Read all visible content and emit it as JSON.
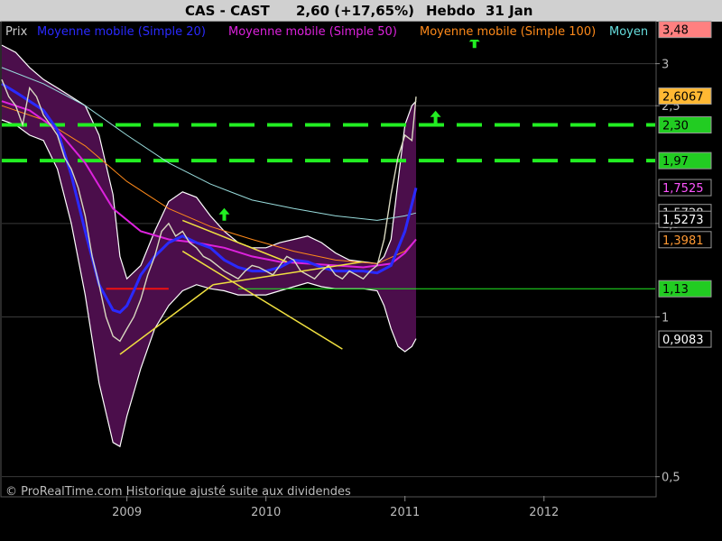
{
  "header": {
    "symbol": "CAS - CAST",
    "price_change": "2,60 (+17,65%)",
    "period": "Hebdo",
    "date": "31 Jan"
  },
  "legend": [
    {
      "label": "Prix",
      "color": "#cccccc"
    },
    {
      "label": "Moyenne mobile (Simple 20)",
      "color": "#2a2aff"
    },
    {
      "label": "Moyenne mobile (Simple 50)",
      "color": "#dd22dd"
    },
    {
      "label": "Moyenne mobile (Simple 100)",
      "color": "#ff8a1a"
    },
    {
      "label": "Moyen",
      "color": "#66dddd"
    }
  ],
  "footer": {
    "copyright": "© ProRealTime.com Historique ajusté suite aux dividendes"
  },
  "colors": {
    "price": "#d8d8c0",
    "bollinger_fill": "#4b0e4b",
    "bollinger_edge": "#ffffff",
    "sma20": "#2a2aff",
    "sma50": "#dd22dd",
    "sma100": "#ff8a1a",
    "sma200": "#99dddd",
    "green_level": "#22ee22",
    "red_level": "#ee1111",
    "trendline": "#f0e040"
  },
  "chart_data": {
    "type": "line",
    "title": "CAS - CAST",
    "period": "Hebdo",
    "y_scale": "log",
    "ylim": [
      0.46,
      3.6
    ],
    "xlim": [
      2008.1,
      2012.8
    ],
    "y_ticks": [
      "0,5",
      "1",
      "1,5",
      "2,5",
      "3"
    ],
    "x_ticks": [
      "2009",
      "2010",
      "2011",
      "2012"
    ],
    "right_labels": [
      {
        "text": "3,48",
        "value": 3.48,
        "bg": "#ff8080",
        "fg": "#000000"
      },
      {
        "text": "2,6067",
        "value": 2.6067,
        "bg": "#ffb833",
        "fg": "#000000"
      },
      {
        "text": "2,30",
        "value": 2.3,
        "bg": "#22cc22",
        "fg": "#000000"
      },
      {
        "text": "1,97",
        "value": 1.97,
        "bg": "#22cc22",
        "fg": "#000000"
      },
      {
        "text": "1,7525",
        "value": 1.7525,
        "bg": "#000000",
        "fg": "#ff55ff"
      },
      {
        "text": "1,5728",
        "value": 1.5728,
        "bg": "#000000",
        "fg": "#dddddd"
      },
      {
        "text": "1,5273",
        "value": 1.5273,
        "bg": "#000000",
        "fg": "#ffffff"
      },
      {
        "text": "1,3981",
        "value": 1.3981,
        "bg": "#000000",
        "fg": "#ff9933"
      },
      {
        "text": "1,13",
        "value": 1.13,
        "bg": "#22cc22",
        "fg": "#000000"
      },
      {
        "text": "0,9083",
        "value": 0.9083,
        "bg": "#000000",
        "fg": "#ffffff"
      }
    ],
    "levels": [
      {
        "value": 3.48,
        "style": "dashed",
        "color": "#ee1111"
      },
      {
        "value": 2.3,
        "style": "dashed",
        "color": "#22ee22"
      },
      {
        "value": 1.97,
        "style": "dashed",
        "color": "#22ee22"
      },
      {
        "value": 1.13,
        "style": "solid",
        "color": "#22ee22",
        "from": 2009.8
      }
    ],
    "price": {
      "x": [
        2008.1,
        2008.15,
        2008.2,
        2008.25,
        2008.3,
        2008.35,
        2008.4,
        2008.45,
        2008.5,
        2008.55,
        2008.6,
        2008.65,
        2008.7,
        2008.75,
        2008.8,
        2008.85,
        2008.9,
        2008.95,
        2009.0,
        2009.05,
        2009.1,
        2009.15,
        2009.2,
        2009.25,
        2009.3,
        2009.35,
        2009.4,
        2009.45,
        2009.5,
        2009.55,
        2009.6,
        2009.65,
        2009.7,
        2009.75,
        2009.8,
        2009.85,
        2009.9,
        2009.95,
        2010.0,
        2010.05,
        2010.1,
        2010.15,
        2010.2,
        2010.25,
        2010.3,
        2010.35,
        2010.4,
        2010.45,
        2010.5,
        2010.55,
        2010.6,
        2010.65,
        2010.7,
        2010.75,
        2010.8,
        2010.85,
        2010.9,
        2010.95,
        2011.0,
        2011.05,
        2011.08
      ],
      "y": [
        2.8,
        2.6,
        2.5,
        2.3,
        2.7,
        2.6,
        2.4,
        2.3,
        2.2,
        2.0,
        1.9,
        1.75,
        1.55,
        1.3,
        1.15,
        1.0,
        0.92,
        0.9,
        0.95,
        1.0,
        1.08,
        1.2,
        1.3,
        1.45,
        1.5,
        1.42,
        1.45,
        1.38,
        1.35,
        1.3,
        1.28,
        1.25,
        1.22,
        1.2,
        1.18,
        1.22,
        1.25,
        1.24,
        1.22,
        1.2,
        1.25,
        1.3,
        1.28,
        1.22,
        1.2,
        1.18,
        1.22,
        1.25,
        1.2,
        1.18,
        1.22,
        1.2,
        1.18,
        1.22,
        1.25,
        1.4,
        1.7,
        2.0,
        2.2,
        2.15,
        2.6
      ]
    },
    "sma20": {
      "x": [
        2008.1,
        2008.2,
        2008.3,
        2008.4,
        2008.5,
        2008.6,
        2008.7,
        2008.8,
        2008.9,
        2008.95,
        2009.0,
        2009.05,
        2009.1,
        2009.2,
        2009.3,
        2009.4,
        2009.5,
        2009.6,
        2009.7,
        2009.8,
        2009.9,
        2010.0,
        2010.1,
        2010.2,
        2010.3,
        2010.4,
        2010.5,
        2010.6,
        2010.7,
        2010.8,
        2010.9,
        2011.0,
        2011.08
      ],
      "y": [
        2.75,
        2.65,
        2.55,
        2.45,
        2.25,
        1.85,
        1.45,
        1.15,
        1.03,
        1.02,
        1.05,
        1.12,
        1.2,
        1.3,
        1.38,
        1.42,
        1.38,
        1.35,
        1.28,
        1.24,
        1.22,
        1.22,
        1.24,
        1.28,
        1.27,
        1.24,
        1.22,
        1.22,
        1.22,
        1.21,
        1.25,
        1.45,
        1.75
      ]
    },
    "sma50": {
      "x": [
        2008.1,
        2008.3,
        2008.5,
        2008.7,
        2008.9,
        2009.1,
        2009.3,
        2009.5,
        2009.7,
        2009.9,
        2010.1,
        2010.3,
        2010.5,
        2010.7,
        2010.9,
        2011.0,
        2011.08
      ],
      "y": [
        2.55,
        2.45,
        2.25,
        1.95,
        1.6,
        1.45,
        1.4,
        1.38,
        1.35,
        1.3,
        1.27,
        1.26,
        1.25,
        1.24,
        1.26,
        1.32,
        1.4
      ]
    },
    "sma100": {
      "x": [
        2008.1,
        2008.4,
        2008.7,
        2009.0,
        2009.3,
        2009.6,
        2009.9,
        2010.2,
        2010.5,
        2010.8,
        2011.0,
        2011.08
      ],
      "y": [
        2.5,
        2.35,
        2.1,
        1.8,
        1.6,
        1.48,
        1.4,
        1.33,
        1.28,
        1.26,
        1.33,
        1.4
      ]
    },
    "sma200": {
      "x": [
        2008.1,
        2008.4,
        2008.7,
        2009.0,
        2009.3,
        2009.6,
        2009.9,
        2010.2,
        2010.5,
        2010.8,
        2011.0,
        2011.08
      ],
      "y": [
        2.95,
        2.75,
        2.5,
        2.2,
        1.95,
        1.78,
        1.66,
        1.6,
        1.55,
        1.52,
        1.55,
        1.57
      ]
    },
    "bollinger": {
      "x": [
        2008.1,
        2008.2,
        2008.3,
        2008.4,
        2008.5,
        2008.6,
        2008.7,
        2008.8,
        2008.9,
        2008.95,
        2009.0,
        2009.1,
        2009.2,
        2009.3,
        2009.4,
        2009.5,
        2009.6,
        2009.7,
        2009.8,
        2009.9,
        2010.0,
        2010.1,
        2010.2,
        2010.3,
        2010.4,
        2010.5,
        2010.6,
        2010.7,
        2010.8,
        2010.85,
        2010.9,
        2010.95,
        2011.0,
        2011.05,
        2011.08
      ],
      "upper": [
        3.25,
        3.15,
        2.95,
        2.8,
        2.7,
        2.6,
        2.5,
        2.2,
        1.7,
        1.3,
        1.18,
        1.25,
        1.45,
        1.65,
        1.72,
        1.68,
        1.55,
        1.45,
        1.38,
        1.35,
        1.35,
        1.38,
        1.4,
        1.42,
        1.38,
        1.32,
        1.28,
        1.27,
        1.26,
        1.3,
        1.4,
        1.8,
        2.3,
        2.5,
        2.55
      ],
      "lower": [
        2.35,
        2.3,
        2.2,
        2.15,
        1.9,
        1.5,
        1.1,
        0.75,
        0.58,
        0.57,
        0.65,
        0.8,
        0.95,
        1.05,
        1.12,
        1.15,
        1.13,
        1.12,
        1.1,
        1.1,
        1.1,
        1.12,
        1.14,
        1.16,
        1.14,
        1.13,
        1.13,
        1.13,
        1.12,
        1.05,
        0.95,
        0.88,
        0.86,
        0.88,
        0.91
      ]
    },
    "red_segment": {
      "x": [
        2008.85,
        2009.3
      ],
      "y": 1.13
    },
    "trendlines": [
      {
        "x1": 2008.95,
        "y1": 0.85,
        "x2": 2009.62,
        "y2": 1.15
      },
      {
        "x1": 2009.62,
        "y1": 1.15,
        "x2": 2010.7,
        "y2": 1.27
      },
      {
        "x1": 2009.4,
        "y1": 1.52,
        "x2": 2010.15,
        "y2": 1.27
      },
      {
        "x1": 2009.4,
        "y1": 1.33,
        "x2": 2010.55,
        "y2": 0.87
      }
    ],
    "arrows": [
      {
        "x": 2011.5,
        "y": 3.3
      },
      {
        "x": 2011.22,
        "y": 2.38
      },
      {
        "x": 2009.7,
        "y": 1.56
      }
    ]
  }
}
